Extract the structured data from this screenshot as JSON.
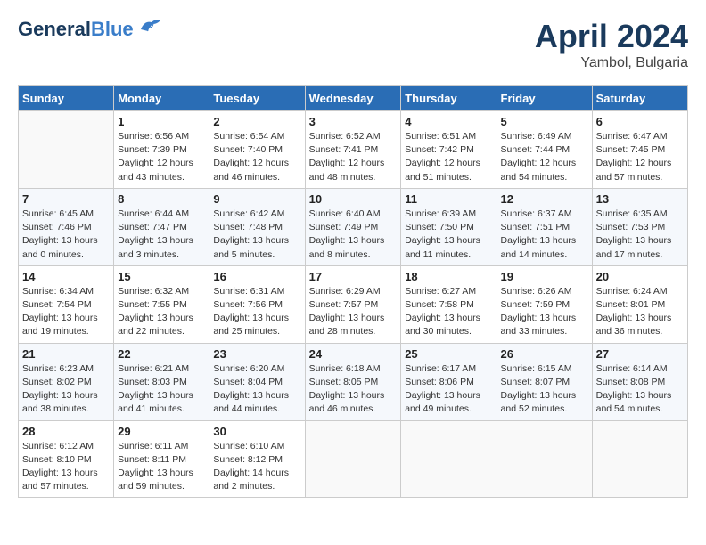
{
  "header": {
    "logo_line1": "General",
    "logo_line2": "Blue",
    "month": "April 2024",
    "location": "Yambol, Bulgaria"
  },
  "days_of_week": [
    "Sunday",
    "Monday",
    "Tuesday",
    "Wednesday",
    "Thursday",
    "Friday",
    "Saturday"
  ],
  "weeks": [
    [
      {
        "day": "",
        "info": ""
      },
      {
        "day": "1",
        "info": "Sunrise: 6:56 AM\nSunset: 7:39 PM\nDaylight: 12 hours\nand 43 minutes."
      },
      {
        "day": "2",
        "info": "Sunrise: 6:54 AM\nSunset: 7:40 PM\nDaylight: 12 hours\nand 46 minutes."
      },
      {
        "day": "3",
        "info": "Sunrise: 6:52 AM\nSunset: 7:41 PM\nDaylight: 12 hours\nand 48 minutes."
      },
      {
        "day": "4",
        "info": "Sunrise: 6:51 AM\nSunset: 7:42 PM\nDaylight: 12 hours\nand 51 minutes."
      },
      {
        "day": "5",
        "info": "Sunrise: 6:49 AM\nSunset: 7:44 PM\nDaylight: 12 hours\nand 54 minutes."
      },
      {
        "day": "6",
        "info": "Sunrise: 6:47 AM\nSunset: 7:45 PM\nDaylight: 12 hours\nand 57 minutes."
      }
    ],
    [
      {
        "day": "7",
        "info": "Sunrise: 6:45 AM\nSunset: 7:46 PM\nDaylight: 13 hours\nand 0 minutes."
      },
      {
        "day": "8",
        "info": "Sunrise: 6:44 AM\nSunset: 7:47 PM\nDaylight: 13 hours\nand 3 minutes."
      },
      {
        "day": "9",
        "info": "Sunrise: 6:42 AM\nSunset: 7:48 PM\nDaylight: 13 hours\nand 5 minutes."
      },
      {
        "day": "10",
        "info": "Sunrise: 6:40 AM\nSunset: 7:49 PM\nDaylight: 13 hours\nand 8 minutes."
      },
      {
        "day": "11",
        "info": "Sunrise: 6:39 AM\nSunset: 7:50 PM\nDaylight: 13 hours\nand 11 minutes."
      },
      {
        "day": "12",
        "info": "Sunrise: 6:37 AM\nSunset: 7:51 PM\nDaylight: 13 hours\nand 14 minutes."
      },
      {
        "day": "13",
        "info": "Sunrise: 6:35 AM\nSunset: 7:53 PM\nDaylight: 13 hours\nand 17 minutes."
      }
    ],
    [
      {
        "day": "14",
        "info": "Sunrise: 6:34 AM\nSunset: 7:54 PM\nDaylight: 13 hours\nand 19 minutes."
      },
      {
        "day": "15",
        "info": "Sunrise: 6:32 AM\nSunset: 7:55 PM\nDaylight: 13 hours\nand 22 minutes."
      },
      {
        "day": "16",
        "info": "Sunrise: 6:31 AM\nSunset: 7:56 PM\nDaylight: 13 hours\nand 25 minutes."
      },
      {
        "day": "17",
        "info": "Sunrise: 6:29 AM\nSunset: 7:57 PM\nDaylight: 13 hours\nand 28 minutes."
      },
      {
        "day": "18",
        "info": "Sunrise: 6:27 AM\nSunset: 7:58 PM\nDaylight: 13 hours\nand 30 minutes."
      },
      {
        "day": "19",
        "info": "Sunrise: 6:26 AM\nSunset: 7:59 PM\nDaylight: 13 hours\nand 33 minutes."
      },
      {
        "day": "20",
        "info": "Sunrise: 6:24 AM\nSunset: 8:01 PM\nDaylight: 13 hours\nand 36 minutes."
      }
    ],
    [
      {
        "day": "21",
        "info": "Sunrise: 6:23 AM\nSunset: 8:02 PM\nDaylight: 13 hours\nand 38 minutes."
      },
      {
        "day": "22",
        "info": "Sunrise: 6:21 AM\nSunset: 8:03 PM\nDaylight: 13 hours\nand 41 minutes."
      },
      {
        "day": "23",
        "info": "Sunrise: 6:20 AM\nSunset: 8:04 PM\nDaylight: 13 hours\nand 44 minutes."
      },
      {
        "day": "24",
        "info": "Sunrise: 6:18 AM\nSunset: 8:05 PM\nDaylight: 13 hours\nand 46 minutes."
      },
      {
        "day": "25",
        "info": "Sunrise: 6:17 AM\nSunset: 8:06 PM\nDaylight: 13 hours\nand 49 minutes."
      },
      {
        "day": "26",
        "info": "Sunrise: 6:15 AM\nSunset: 8:07 PM\nDaylight: 13 hours\nand 52 minutes."
      },
      {
        "day": "27",
        "info": "Sunrise: 6:14 AM\nSunset: 8:08 PM\nDaylight: 13 hours\nand 54 minutes."
      }
    ],
    [
      {
        "day": "28",
        "info": "Sunrise: 6:12 AM\nSunset: 8:10 PM\nDaylight: 13 hours\nand 57 minutes."
      },
      {
        "day": "29",
        "info": "Sunrise: 6:11 AM\nSunset: 8:11 PM\nDaylight: 13 hours\nand 59 minutes."
      },
      {
        "day": "30",
        "info": "Sunrise: 6:10 AM\nSunset: 8:12 PM\nDaylight: 14 hours\nand 2 minutes."
      },
      {
        "day": "",
        "info": ""
      },
      {
        "day": "",
        "info": ""
      },
      {
        "day": "",
        "info": ""
      },
      {
        "day": "",
        "info": ""
      }
    ]
  ]
}
